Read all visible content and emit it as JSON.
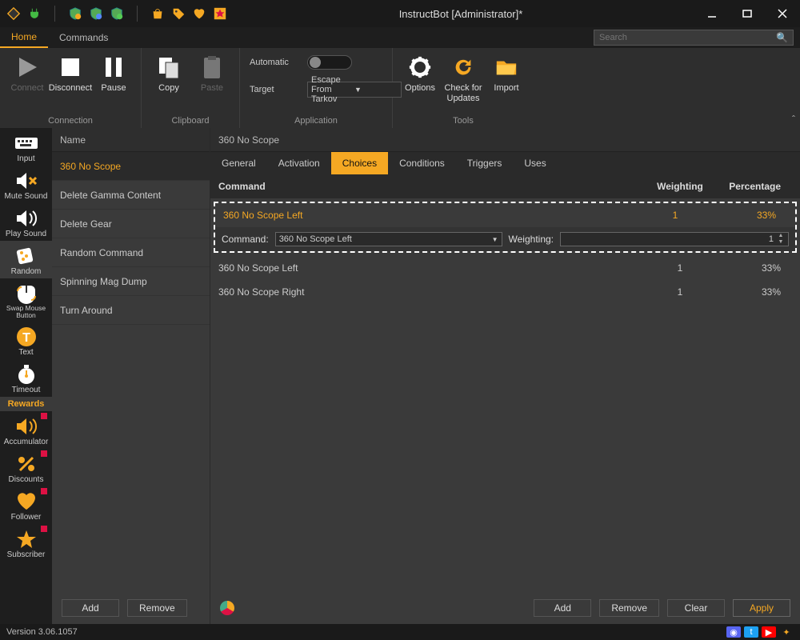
{
  "window": {
    "title": "InstructBot [Administrator]*"
  },
  "toptabs": {
    "home": "Home",
    "commands": "Commands"
  },
  "search": {
    "placeholder": "Search"
  },
  "ribbon": {
    "connection": {
      "label": "Connection",
      "connect": "Connect",
      "disconnect": "Disconnect",
      "pause": "Pause"
    },
    "clipboard": {
      "label": "Clipboard",
      "copy": "Copy",
      "paste": "Paste"
    },
    "application": {
      "label": "Application",
      "automatic": "Automatic",
      "target": "Target",
      "target_value": "Escape From Tarkov"
    },
    "tools": {
      "label": "Tools",
      "options": "Options",
      "updates": "Check for Updates",
      "import": "Import"
    }
  },
  "leftrail": {
    "input": "Input",
    "mute": "Mute Sound",
    "play": "Play Sound",
    "random": "Random",
    "swap": "Swap Mouse Button",
    "text": "Text",
    "timeout": "Timeout",
    "rewards_header": "Rewards",
    "accumulator": "Accumulator",
    "discounts": "Discounts",
    "follower": "Follower",
    "subscriber": "Subscriber"
  },
  "midcol": {
    "header": "Name",
    "items": [
      "360 No Scope",
      "Delete Gamma Content",
      "Delete Gear",
      "Random Command",
      "Spinning Mag Dump",
      "Turn Around"
    ],
    "btn_add": "Add",
    "btn_remove": "Remove"
  },
  "content": {
    "header": "360 No Scope",
    "tabs": {
      "general": "General",
      "activation": "Activation",
      "choices": "Choices",
      "conditions": "Conditions",
      "triggers": "Triggers",
      "uses": "Uses"
    },
    "columns": {
      "command": "Command",
      "weighting": "Weighting",
      "percentage": "Percentage"
    },
    "rows": [
      {
        "command": "360 No Scope Left",
        "weighting": "1",
        "percentage": "33%"
      },
      {
        "command": "360 No Scope Left",
        "weighting": "1",
        "percentage": "33%"
      },
      {
        "command": "360 No Scope Right",
        "weighting": "1",
        "percentage": "33%"
      }
    ],
    "editor": {
      "command_label": "Command:",
      "command_value": "360 No Scope Left",
      "weighting_label": "Weighting:",
      "weighting_value": "1"
    },
    "footer": {
      "add": "Add",
      "remove": "Remove",
      "clear": "Clear",
      "apply": "Apply"
    }
  },
  "status": {
    "version": "Version 3.06.1057"
  }
}
